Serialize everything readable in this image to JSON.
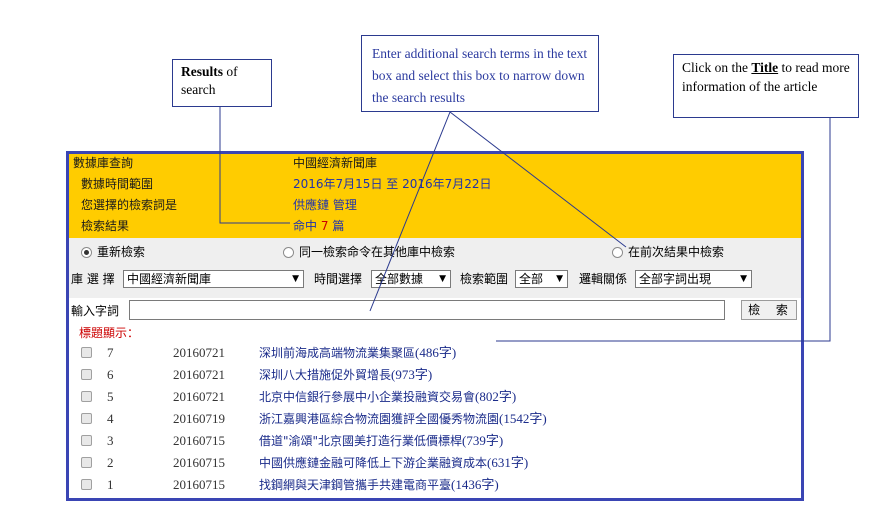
{
  "callouts": {
    "results_bold": "Results",
    "results_rest": " of search",
    "narrow": "Enter additional search terms in the text box and select this box to narrow down the search results",
    "title_pre": "Click on the ",
    "title_bold": "Title",
    "title_post": " to read more information  of the article"
  },
  "info": {
    "db_label": "數據庫查詢",
    "db_value": "中國經濟新聞庫",
    "time_label": "數據時間範圍",
    "time_value": "2016年7月15日 至 2016年7月22日",
    "terms_label": "您選擇的檢索詞是",
    "terms_value": "供應鏈 管理",
    "result_label": "檢索結果",
    "result_prefix": "命中",
    "result_count": "7",
    "result_suffix": "篇"
  },
  "options": {
    "new_search": "重新檢索",
    "same_in_other": "同一檢索命令在其他庫中檢索",
    "in_previous": "在前次結果中檢索"
  },
  "filters": {
    "db_label": "庫 選 擇",
    "db_value": "中國經濟新聞庫",
    "time_label": "時間選擇",
    "time_value": "全部數據",
    "range_label": "檢索範圍",
    "range_value": "全部",
    "logic_label": "邏輯關係",
    "logic_value": "全部字詞出現"
  },
  "search": {
    "input_label": "輸入字詞",
    "input_value": "",
    "button_label": "檢 索"
  },
  "results": {
    "header": "標題顯示：",
    "items": [
      {
        "num": "7",
        "date": "20160721",
        "title": "深圳前海成高端物流業集聚區",
        "words": "(486字)"
      },
      {
        "num": "6",
        "date": "20160721",
        "title": "深圳八大措施促外貿增長",
        "words": "(973字)"
      },
      {
        "num": "5",
        "date": "20160721",
        "title": "北京中信銀行參展中小企業投融資交易會",
        "words": "(802字)"
      },
      {
        "num": "4",
        "date": "20160719",
        "title": "浙江嘉興港區綜合物流園獲評全國優秀物流園",
        "words": "(1542字)"
      },
      {
        "num": "3",
        "date": "20160715",
        "title": "借道\"渝頌\"北京國美打造行業低價標桿",
        "words": "(739字)"
      },
      {
        "num": "2",
        "date": "20160715",
        "title": "中國供應鏈金融可降低上下游企業融資成本",
        "words": "(631字)"
      },
      {
        "num": "1",
        "date": "20160715",
        "title": "找鋼網與天津鋼管攜手共建電商平臺",
        "words": "(1436字)"
      }
    ]
  },
  "colors": {
    "frame": "#3a45b4",
    "info_bg": "#ffcc00",
    "link": "#1a2b8a",
    "highlight": "#cc0000"
  }
}
